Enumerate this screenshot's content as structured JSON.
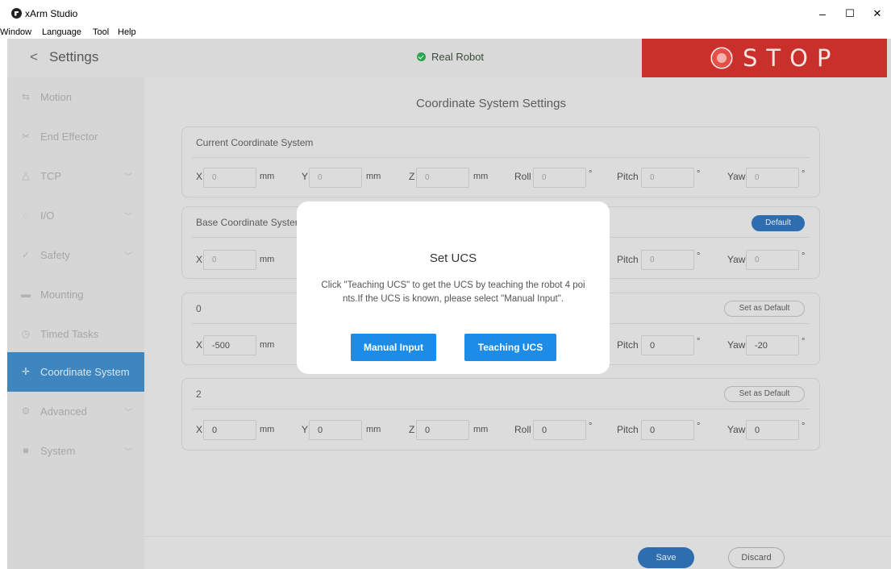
{
  "window": {
    "title": "xArm Studio",
    "menu": [
      "Window",
      "Language",
      "Tool",
      "Help"
    ],
    "controls": {
      "minimize": "–",
      "maximize": "☐",
      "close": "✕"
    }
  },
  "header": {
    "back_label": "Settings",
    "status": "Real Robot",
    "stop_label": "STOP",
    "colors": {
      "stop": "#c9302c",
      "status": "#27a64a"
    }
  },
  "sidebar": {
    "items": [
      {
        "label": "Motion",
        "icon": "motion-icon",
        "expandable": false
      },
      {
        "label": "End Effector",
        "icon": "end-effector-icon",
        "expandable": false
      },
      {
        "label": "TCP",
        "icon": "tcp-icon",
        "expandable": true
      },
      {
        "label": "I/O",
        "icon": "io-icon",
        "expandable": true
      },
      {
        "label": "Safety",
        "icon": "safety-icon",
        "expandable": true
      },
      {
        "label": "Mounting",
        "icon": "mounting-icon",
        "expandable": false
      },
      {
        "label": "Timed Tasks",
        "icon": "timed-tasks-icon",
        "expandable": false
      },
      {
        "label": "Coordinate System",
        "icon": "coordinate-system-icon",
        "expandable": false,
        "active": true
      },
      {
        "label": "Advanced",
        "icon": "advanced-icon",
        "expandable": true
      },
      {
        "label": "System",
        "icon": "system-icon",
        "expandable": true
      }
    ],
    "accent": "#3f86bf"
  },
  "main": {
    "title": "Coordinate System Settings",
    "labels": {
      "x": "X",
      "y": "Y",
      "z": "Z",
      "roll": "Roll",
      "pitch": "Pitch",
      "yaw": "Yaw",
      "mm": "mm",
      "deg": "°"
    },
    "cards": {
      "current": {
        "title": "Current Coordinate System",
        "values": {
          "x": "0",
          "y": "0",
          "z": "0",
          "roll": "0",
          "pitch": "0",
          "yaw": "0"
        }
      },
      "base": {
        "title": "Base Coordinate Syster",
        "button": "Default",
        "values": {
          "x": "0",
          "pitch": "0",
          "yaw": "0"
        }
      },
      "c0": {
        "title": "0",
        "button": "Set as Default",
        "values": {
          "x": "-500",
          "pitch": "0",
          "yaw": "-20"
        }
      },
      "c2": {
        "title": "2",
        "button": "Set as Default",
        "values": {
          "x": "0",
          "y": "0",
          "z": "0",
          "roll": "0",
          "pitch": "0",
          "yaw": "0"
        }
      }
    }
  },
  "footer": {
    "save": "Save",
    "discard": "Discard"
  },
  "modal": {
    "title": "Set UCS",
    "message_line1": "Click \"Teaching UCS\" to get the UCS by teaching the robot 4 poi",
    "message_line2": "nts.If the UCS is known, please select \"Manual Input\".",
    "manual_button": "Manual Input",
    "teaching_button": "Teaching UCS",
    "button_color": "#1d8ce6"
  }
}
